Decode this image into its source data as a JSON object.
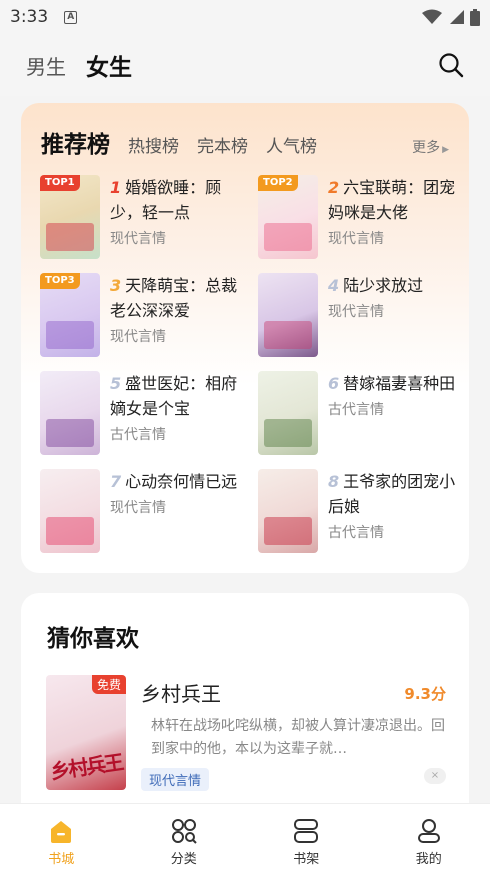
{
  "status_bar": {
    "time": "3:33",
    "notification_icon": "A"
  },
  "top_nav": {
    "tabs": [
      "男生",
      "女生"
    ],
    "active_tab": "女生",
    "search_icon": "search-icon"
  },
  "ranking": {
    "title": "推荐榜",
    "sub_tabs": [
      "热搜榜",
      "完本榜",
      "人气榜"
    ],
    "more_label": "更多",
    "books": [
      {
        "rank": "1",
        "badge": "TOP1",
        "title": "婚婚欲睡：顾少，轻一点",
        "genre": "现代言情"
      },
      {
        "rank": "2",
        "badge": "TOP2",
        "title": "六宝联萌：团宠妈咪是大佬",
        "genre": "现代言情"
      },
      {
        "rank": "3",
        "badge": "TOP3",
        "title": "天降萌宝：总裁老公深深爱",
        "genre": "现代言情"
      },
      {
        "rank": "4",
        "badge": "",
        "title": "陆少求放过",
        "genre": "现代言情"
      },
      {
        "rank": "5",
        "badge": "",
        "title": "盛世医妃：相府嫡女是个宝",
        "genre": "古代言情"
      },
      {
        "rank": "6",
        "badge": "",
        "title": "替嫁福妻喜种田",
        "genre": "古代言情"
      },
      {
        "rank": "7",
        "badge": "",
        "title": "心动奈何情已远",
        "genre": "现代言情"
      },
      {
        "rank": "8",
        "badge": "",
        "title": "王爷家的团宠小后娘",
        "genre": "古代言情"
      }
    ]
  },
  "guess": {
    "title": "猜你喜欢",
    "item": {
      "badge": "免费",
      "cover_title": "乡村兵王",
      "title": "乡村兵王",
      "score": "9.3分",
      "description": "林轩在战场叱咤纵横，却被人算计凄凉退出。回到家中的他，本以为这辈子就…",
      "genre": "现代言情",
      "close": "×"
    }
  },
  "bottom_nav": [
    {
      "label": "书城",
      "icon": "bookstore-icon",
      "active": true
    },
    {
      "label": "分类",
      "icon": "category-icon",
      "active": false
    },
    {
      "label": "书架",
      "icon": "bookshelf-icon",
      "active": false
    },
    {
      "label": "我的",
      "icon": "profile-icon",
      "active": false
    }
  ],
  "colors": {
    "accent": "#f0a21f",
    "rank_red": "#e8412f",
    "score": "#f08a2b"
  }
}
